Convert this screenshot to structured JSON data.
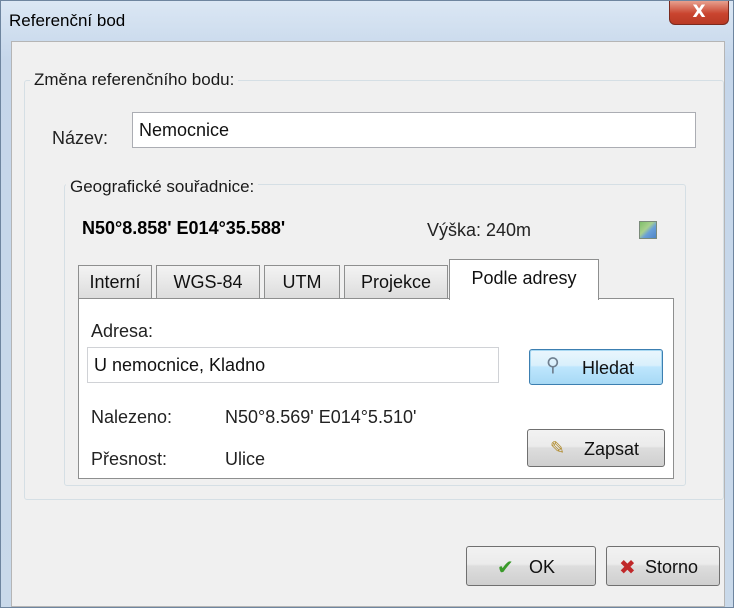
{
  "window": {
    "title": "Referenční bod",
    "close_label": "X"
  },
  "group_main": {
    "legend": "Změna referenčního bodu:"
  },
  "name_field": {
    "label": "Název:",
    "value": "Nemocnice"
  },
  "group_geo": {
    "legend": "Geografické souřadnice:"
  },
  "coordinates": {
    "value": "N50°8.858' E014°35.588'",
    "altitude": "Výška: 240m",
    "map_icon": "map-icon"
  },
  "tabs": [
    {
      "label": "Interní"
    },
    {
      "label": "WGS-84"
    },
    {
      "label": "UTM"
    },
    {
      "label": "Projekce"
    },
    {
      "label": "Podle adresy"
    }
  ],
  "active_tab": "Podle adresy",
  "address_panel": {
    "address_label": "Adresa:",
    "address_value": "U nemocnice, Kladno",
    "search_button": "Hledat",
    "search_icon": "magnifier-icon",
    "found_label": "Nalezeno:",
    "found_value": "N50°8.569' E014°5.510'",
    "precision_label": "Přesnost:",
    "precision_value": "Ulice",
    "write_button": "Zapsat",
    "write_icon": "pencil-icon"
  },
  "footer": {
    "ok_label": "OK",
    "ok_icon": "checkmark-icon",
    "cancel_label": "Storno",
    "cancel_icon": "cross-icon"
  },
  "colors": {
    "ok_icon": "#3a9a2a",
    "cancel_icon": "#c0282a",
    "close_button": "#c9442f"
  }
}
